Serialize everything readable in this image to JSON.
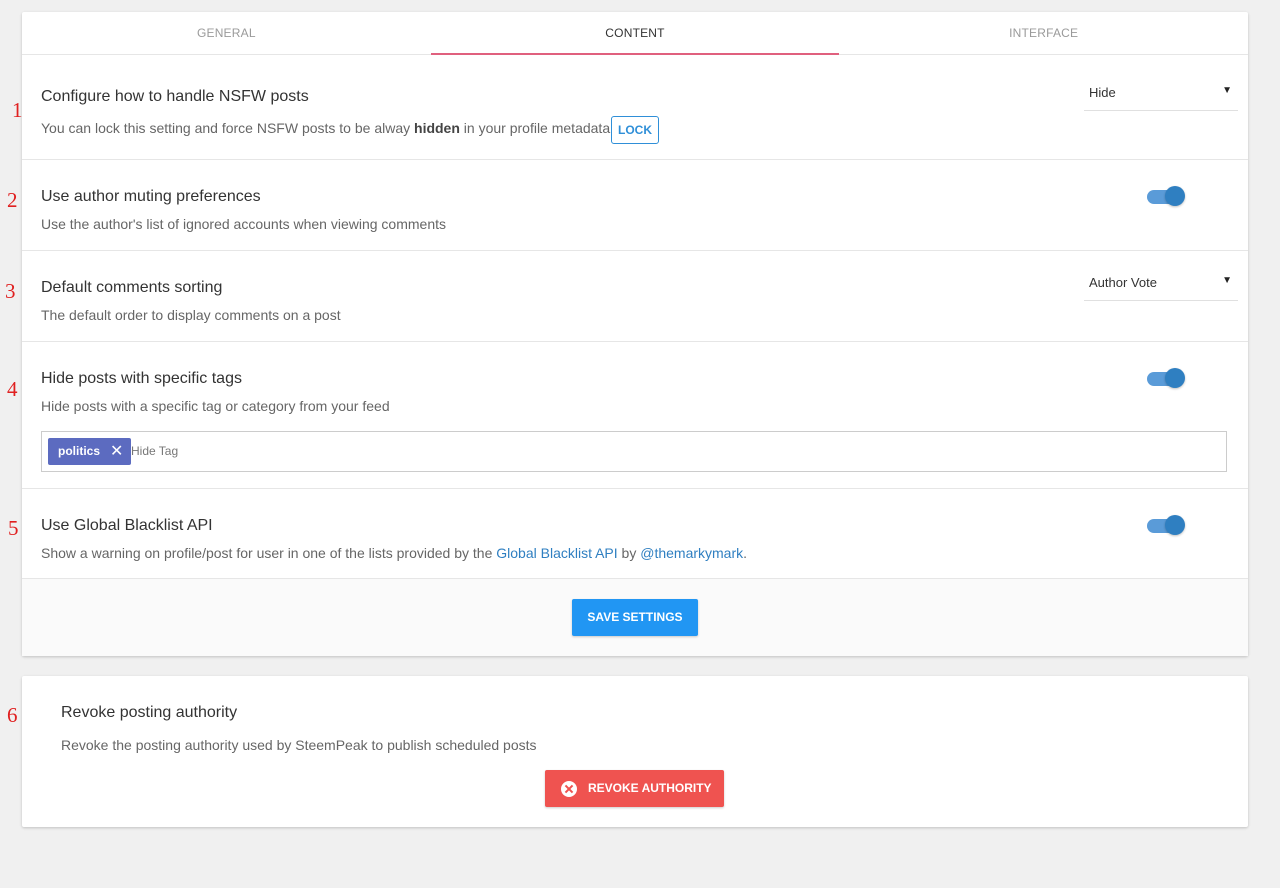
{
  "tabs": [
    {
      "label": "GENERAL",
      "active": false
    },
    {
      "label": "CONTENT",
      "active": true
    },
    {
      "label": "INTERFACE",
      "active": false
    }
  ],
  "annotations": [
    "1",
    "2",
    "3",
    "4",
    "5",
    "6"
  ],
  "nsfw": {
    "title": "Configure how to handle NSFW posts",
    "desc_before": "You can lock this setting and force NSFW posts to be alway ",
    "desc_bold": "hidden",
    "desc_after": " in your profile metadata.",
    "lock_label": "LOCK",
    "select_value": "Hide",
    "caret": "▼"
  },
  "author_muting": {
    "title": "Use author muting preferences",
    "desc": "Use the author's list of ignored accounts when viewing comments",
    "enabled": true
  },
  "comments_sorting": {
    "title": "Default comments sorting",
    "desc": "The default order to display comments on a post",
    "select_value": "Author Vote",
    "caret": "▼"
  },
  "hide_tags": {
    "title": "Hide posts with specific tags",
    "desc": "Hide posts with a specific tag or category from your feed",
    "enabled": true,
    "tags": [
      "politics"
    ],
    "remove_icon": "✕",
    "input_placeholder": "Hide Tag"
  },
  "blacklist": {
    "title": "Use Global Blacklist API",
    "desc_before": "Show a warning on profile/post for user in one of the lists provided by the ",
    "link1": "Global Blacklist API",
    "desc_middle": " by ",
    "link2": "@themarkymark",
    "desc_after": ".",
    "enabled": true
  },
  "save_label": "SAVE SETTINGS",
  "revoke": {
    "title": "Revoke posting authority",
    "desc": "Revoke the posting authority used by SteemPeak to publish scheduled posts",
    "button_label": "REVOKE AUTHORITY",
    "button_icon": "close-circle-icon"
  },
  "colors": {
    "accent_tab": "#e0607e",
    "toggle": "#2f7fc1",
    "save": "#2196f3",
    "revoke": "#ef5350",
    "tag_chip": "#5c6bc0",
    "annotation": "#e02020"
  }
}
